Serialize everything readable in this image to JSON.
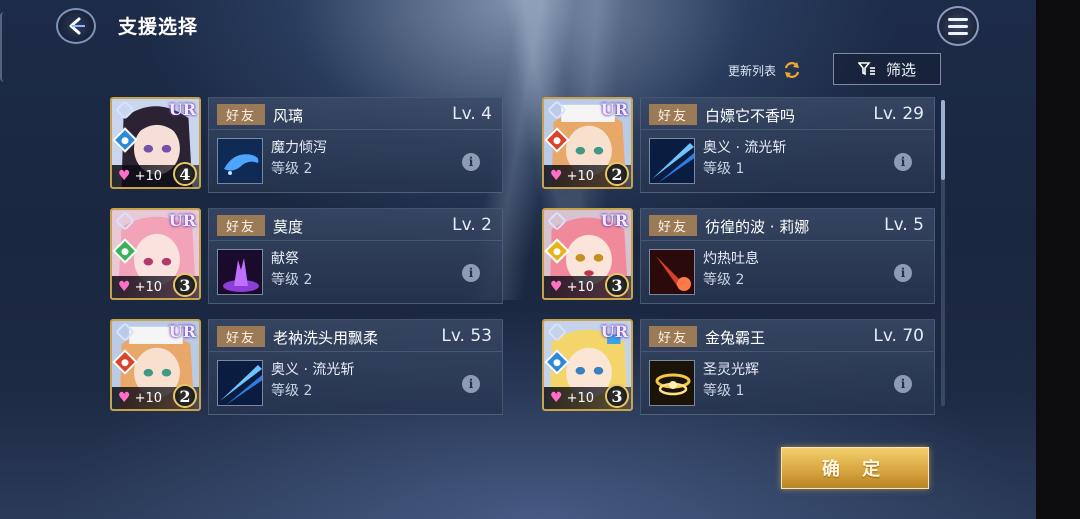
{
  "header": {
    "title": "支援选择",
    "refresh_label": "更新列表",
    "filter_label": "筛选"
  },
  "colors": {
    "accent_gold": "#d9a640",
    "friend_tag": "#9b7a57",
    "panel": "#3a4a66"
  },
  "cards": [
    {
      "tag": "好友",
      "name": "风璃",
      "level": "Lv. 4",
      "skill": "魔力倾泻",
      "skill_level": "等级 2",
      "bond": "+10",
      "stars": "4",
      "rarity": "UR",
      "element": "water",
      "skill_icon": "dolphin-skill-icon"
    },
    {
      "tag": "好友",
      "name": "白嫖它不香吗",
      "level": "Lv. 29",
      "skill": "奥义 · 流光斩",
      "skill_level": "等级 1",
      "bond": "+10",
      "stars": "2",
      "rarity": "UR",
      "element": "fire",
      "skill_icon": "slash-skill-icon"
    },
    {
      "tag": "好友",
      "name": "莫度",
      "level": "Lv. 2",
      "skill": "献祭",
      "skill_level": "等级 2",
      "bond": "+10",
      "stars": "3",
      "rarity": "UR",
      "element": "wind",
      "skill_icon": "sacrifice-skill-icon"
    },
    {
      "tag": "好友",
      "name": "彷徨的波 · 莉娜",
      "level": "Lv. 5",
      "skill": "灼热吐息",
      "skill_level": "等级 2",
      "bond": "+10",
      "stars": "3",
      "rarity": "UR",
      "element": "light",
      "skill_icon": "breath-skill-icon"
    },
    {
      "tag": "好友",
      "name": "老衲洗头用飘柔",
      "level": "Lv. 53",
      "skill": "奥义 · 流光斩",
      "skill_level": "等级 2",
      "bond": "+10",
      "stars": "2",
      "rarity": "UR",
      "element": "fire",
      "skill_icon": "slash-skill-icon"
    },
    {
      "tag": "好友",
      "name": "金兔霸王",
      "level": "Lv. 70",
      "skill": "圣灵光辉",
      "skill_level": "等级 1",
      "bond": "+10",
      "stars": "3",
      "rarity": "UR",
      "element": "water",
      "skill_icon": "halo-skill-icon"
    }
  ],
  "confirm_label": "确 定"
}
